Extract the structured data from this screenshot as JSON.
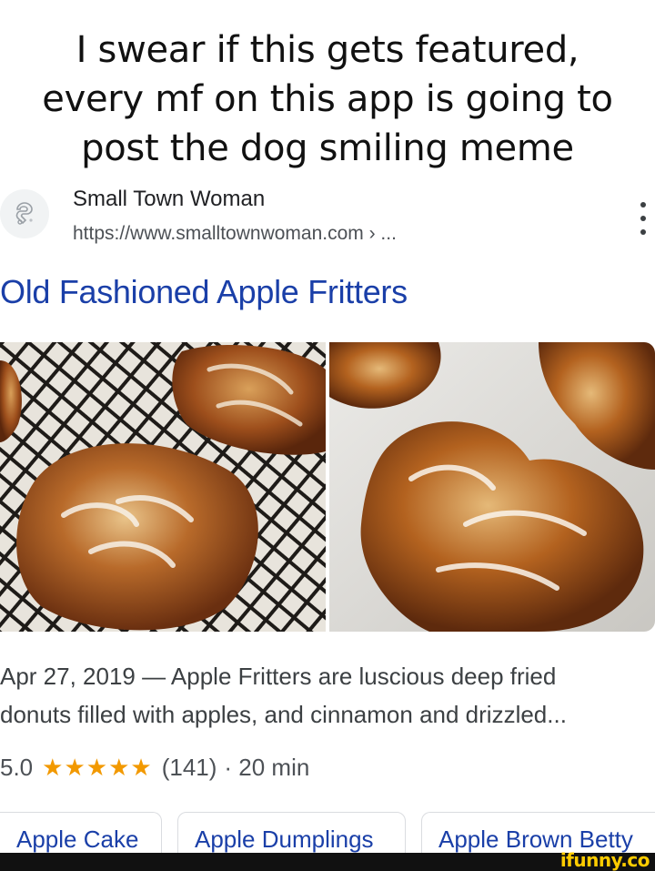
{
  "caption": {
    "line1": "I swear if this gets featured,",
    "line2": "every mf on this app is going to",
    "line3": "post the dog smiling meme"
  },
  "source": {
    "site_name": "Small Town Woman",
    "url": "https://www.smalltownwoman.com › ...",
    "favicon_icon": "site-favicon-icon",
    "menu_icon": "more-vert-icon"
  },
  "result": {
    "title": "Old Fashioned Apple Fritters",
    "images": [
      "apple-fritters-on-rack-photo",
      "apple-fritters-on-parchment-photo"
    ],
    "snippet_line1": "Apr 27, 2019 — Apple Fritters are luscious deep fried",
    "snippet_line2": "donuts filled with apples, and cinnamon and drizzled...",
    "rating": "5.0",
    "stars": "★★★★★",
    "stars_value": 5,
    "reviews": "(141)",
    "time": "· 20 min"
  },
  "chips": [
    "Apple Cake",
    "Apple Dumplings",
    "Apple Brown Betty"
  ],
  "watermark": "ifunny.co",
  "colors": {
    "link": "#1a3fa8",
    "star": "#f29900",
    "text": "#202124",
    "watermark": "#ffcc00"
  }
}
